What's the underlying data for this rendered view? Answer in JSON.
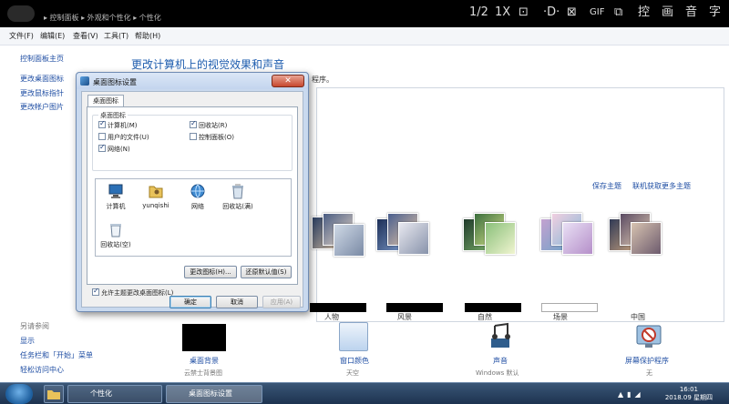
{
  "player": {
    "breadcrumb": "▸ 控制面板 ▸ 外观和个性化 ▸ 个性化",
    "controls": [
      "1/2",
      "1X",
      "⊡",
      "·D·",
      "⊠",
      "GIF",
      "⧉",
      "控",
      "画",
      "音",
      "字"
    ]
  },
  "menu": [
    "文件(F)",
    "编辑(E)",
    "查看(V)",
    "工具(T)",
    "帮助(H)"
  ],
  "leftnav": {
    "home": "控制面板主页",
    "links": [
      "更改桌面图标",
      "更改鼠标指针",
      "更改帐户图片"
    ],
    "see_also_header": "另请参阅",
    "see_also": [
      "显示",
      "任务栏和「开始」菜单",
      "轻松访问中心"
    ]
  },
  "main": {
    "title": "更改计算机上的视觉效果和声音",
    "desc": "程序。",
    "save_theme": "保存主题",
    "get_more": "联机获取更多主题",
    "themes": [
      "人物",
      "风景",
      "自然",
      "场景",
      "中国"
    ],
    "bottom": [
      {
        "label": "桌面背景",
        "sub": "云禁士背景图"
      },
      {
        "label": "窗口颜色",
        "sub": "天空"
      },
      {
        "label": "声音",
        "sub": "Windows 默认"
      },
      {
        "label": "屏幕保护程序",
        "sub": "无"
      }
    ]
  },
  "dialog": {
    "title": "桌面图标设置",
    "close_glyph": "✕",
    "tab": "桌面图标",
    "group_title": "桌面图标",
    "checkboxes": [
      {
        "label": "计算机(M)",
        "checked": true
      },
      {
        "label": "回收站(R)",
        "checked": true
      },
      {
        "label": "用户的文件(U)",
        "checked": false
      },
      {
        "label": "控制面板(O)",
        "checked": false
      },
      {
        "label": "网络(N)",
        "checked": true
      }
    ],
    "icons": [
      {
        "label": "计算机",
        "icon": "computer-icon"
      },
      {
        "label": "yunqishi",
        "icon": "user-folder-icon"
      },
      {
        "label": "网络",
        "icon": "network-icon"
      },
      {
        "label": "回收站(满)",
        "icon": "recycle-bin-full-icon"
      },
      {
        "label": "回收站(空)",
        "icon": "recycle-bin-empty-icon"
      }
    ],
    "change_icon": "更改图标(H)...",
    "restore_default": "还原默认值(S)",
    "allow_theme": "允许主题更改桌面图标(L)",
    "ok": "确定",
    "cancel": "取消",
    "apply": "应用(A)"
  },
  "taskbar": {
    "items": [
      "个性化",
      "桌面图标设置"
    ],
    "time": "16:01",
    "date": "2018.09 星期四"
  },
  "colors": {
    "link": "#1f4ea3",
    "title_blue": "#1d5cae",
    "dialog_frame": "#c9d9ee",
    "taskbar": "#1d3350"
  }
}
